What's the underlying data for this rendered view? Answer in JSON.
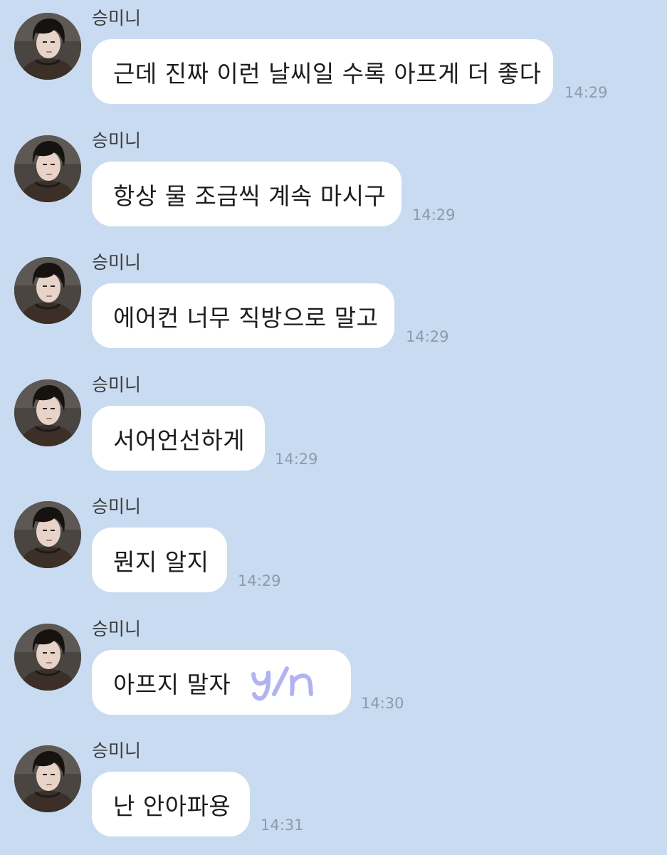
{
  "messages": [
    {
      "sender": "승미니",
      "text": "근데 진짜 이런 날씨일 수록 아프게 더 좋다",
      "time": "14:29"
    },
    {
      "sender": "승미니",
      "text": "항상 물 조금씩 계속 마시구",
      "time": "14:29"
    },
    {
      "sender": "승미니",
      "text": "에어컨 너무 직방으로 말고",
      "time": "14:29"
    },
    {
      "sender": "승미니",
      "text": "서어언선하게",
      "time": "14:29"
    },
    {
      "sender": "승미니",
      "text": "뭔지 알지",
      "time": "14:29"
    },
    {
      "sender": "승미니",
      "text": "아프지 말자",
      "time": "14:30",
      "sticker": "y/n"
    },
    {
      "sender": "승미니",
      "text": "난 안아파용",
      "time": "14:31"
    }
  ],
  "colors": {
    "background": "#c9dbf1",
    "bubble": "#ffffff",
    "timestamp": "#8d9aac",
    "sticker": "#a9abf0"
  }
}
